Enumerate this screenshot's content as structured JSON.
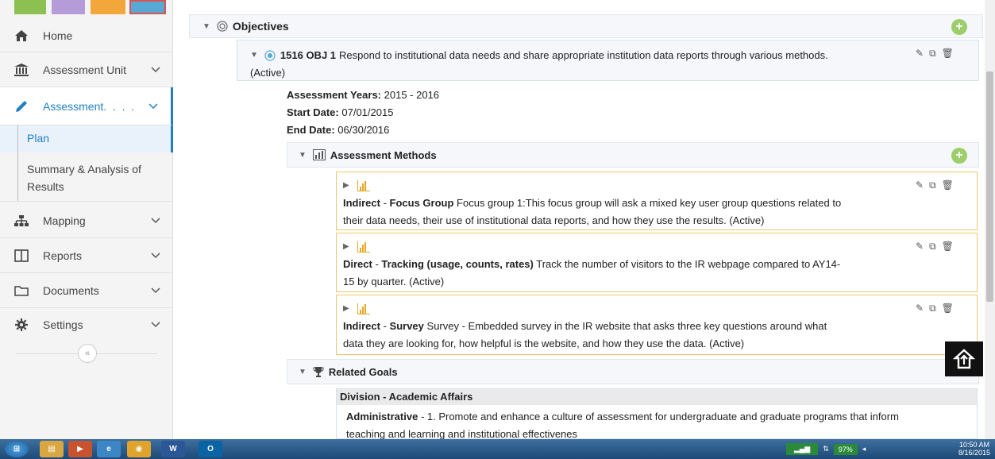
{
  "sidebar": {
    "strip_colors": [
      "#8cc152",
      "#b59bd8",
      "#f3a73a",
      "#58a8d6"
    ],
    "items": [
      {
        "label": "Home",
        "icon": "home-icon"
      },
      {
        "label": "Assessment Unit",
        "icon": "institution-icon"
      },
      {
        "label": "Assessment.  .  .  .",
        "icon": "pencil-icon"
      },
      {
        "label": "Mapping",
        "icon": "sitemap-icon"
      },
      {
        "label": "Reports",
        "icon": "columns-icon"
      },
      {
        "label": "Documents",
        "icon": "folder-icon"
      },
      {
        "label": "Settings",
        "icon": "gear-icon"
      }
    ],
    "sub_items": [
      {
        "label": "Plan"
      },
      {
        "label_line1": "Summary & Analysis of",
        "label_line2": "Results"
      }
    ],
    "collapse_label": "«"
  },
  "objectives": {
    "title": "Objectives",
    "objective": {
      "code": "1516 OBJ 1",
      "text": "Respond to institutional data needs and share appropriate institution data reports through various methods.",
      "status": "(Active)"
    },
    "details": {
      "years_label": "Assessment Years:",
      "years_value": "2015 - 2016",
      "start_label": "Start Date:",
      "start_value": "07/01/2015",
      "end_label": "End Date:",
      "end_value": "06/30/2016"
    }
  },
  "assessment_methods": {
    "title": "Assessment Methods",
    "items": [
      {
        "type": "Indirect",
        "method": "Focus Group",
        "line1": "Focus group 1:This focus group will ask a mixed key user group questions related to",
        "line2": "their data needs, their use of institutional data reports, and how they use the results. (Active)"
      },
      {
        "type": "Direct",
        "method": "Tracking (usage, counts, rates)",
        "line1": "Track the number of visitors to the IR webpage compared to AY14-",
        "line2": "15 by quarter. (Active)"
      },
      {
        "type": "Indirect",
        "method": "Survey",
        "line1": "Survey - Embedded survey in the IR website that asks three key questions around what",
        "line2": "data they are looking for, how helpful is the website, and how they use the data. (Active)"
      }
    ]
  },
  "related_goals": {
    "title": "Related Goals",
    "division": "Division - Academic Affairs",
    "goal_type": "Administrative",
    "goal_line1": "- 1. Promote and enhance a culture of assessment for undergraduate and graduate programs that inform",
    "goal_line2": "teaching and learning and institutional effectivenes"
  },
  "taskbar": {
    "word_label": "W",
    "outlook_label": "O",
    "battery": "97%",
    "time": "10:50 AM",
    "date": "8/16/2015"
  }
}
